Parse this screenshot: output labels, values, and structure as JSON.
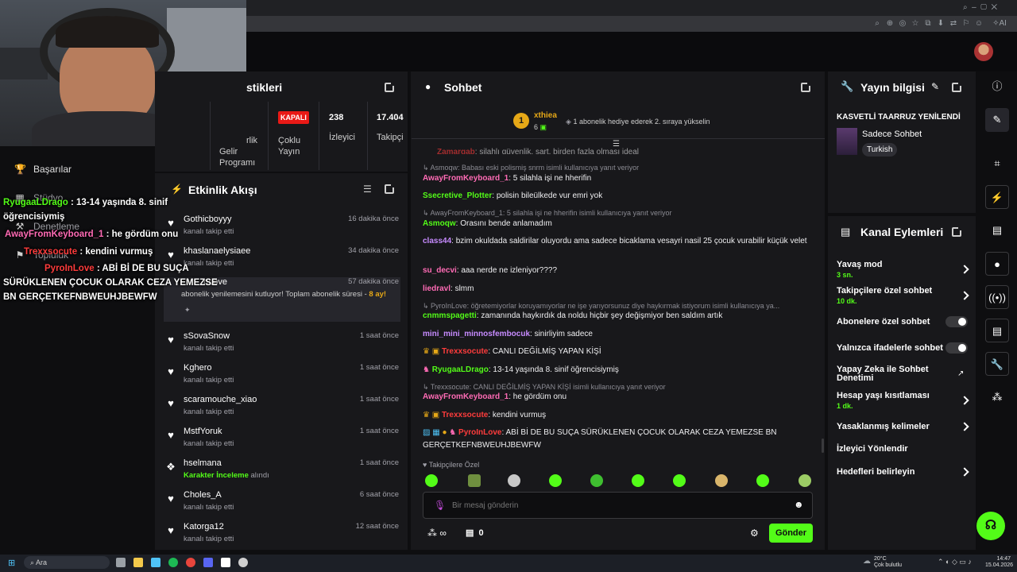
{
  "colors": {
    "accent": "#53fc18",
    "panel": "#18181b",
    "bg": "#0e0e10",
    "live_off": "#e91916",
    "sub_gold": "#e6a817"
  },
  "left_nav": {
    "items": [
      {
        "label": "Başarılar",
        "icon": "trophy-icon"
      },
      {
        "label": "Stüdyo",
        "icon": "studio-icon"
      },
      {
        "label": "Denetleme",
        "icon": "shield-icon"
      },
      {
        "label": "Topluluk",
        "icon": "community-icon"
      }
    ]
  },
  "overlay_chat": [
    {
      "user": "RyugaaLDrago",
      "text": " : 13-14 yaşında 8. sinif"
    },
    {
      "text": "öğrencisiymiş"
    },
    {
      "user": "AwayFromKeyboard_1",
      "text": " : he gördüm onu"
    },
    {
      "user": "Trexxsocute",
      "text": " : kendini vurmuş"
    },
    {
      "user": "PyroInLove",
      "text": " : ABİ Bİ DE BU SUÇA"
    },
    {
      "text": "SÜRÜKLENEN ÇOCUK OLARAK CEZA YEMEZSE"
    },
    {
      "text": "BN GERÇETKEFNBWEUHJBEWFW"
    }
  ],
  "stats_panel": {
    "title": "stikleri",
    "cols": [
      {
        "label1": "rlik",
        "label2": "Gelir Programı"
      },
      {
        "badge": "KAPALI",
        "label": "Çoklu Yayın"
      },
      {
        "value": "238",
        "label": "İzleyici"
      },
      {
        "value": "17.404",
        "label": "Takipçi"
      }
    ]
  },
  "activity": {
    "title": "Etkinlik Akışı",
    "rows": [
      {
        "user": "Gothicboyyy",
        "desc": "kanalı takip etti",
        "time": "16 dakika önce",
        "icon": "heart-icon"
      },
      {
        "user": "khaslanaelysiaee",
        "desc": "kanalı takip etti",
        "time": "34 dakika önce",
        "icon": "heart-icon"
      },
      {
        "user": "nLove",
        "desc": "abonelik yenilemesini kutluyor! Toplam abonelik süresi - ",
        "months": "8 ay!",
        "time": "57 dakika önce",
        "icon": "subscription-icon"
      },
      {
        "user": "sSovaSnow",
        "desc": "kanalı takip etti",
        "time": "1 saat önce",
        "icon": "heart-icon"
      },
      {
        "user": "Kghero",
        "desc": "kanalı takip etti",
        "time": "1 saat önce",
        "icon": "heart-icon"
      },
      {
        "user": "scaramouche_xiao",
        "desc": "kanalı takip etti",
        "time": "1 saat önce",
        "icon": "heart-icon"
      },
      {
        "user": "MstfYoruk",
        "desc": "kanalı takip etti",
        "time": "1 saat önce",
        "icon": "heart-icon"
      },
      {
        "user": "hselmana",
        "desc_link": "Karakter İnceleme",
        "desc": " alındı",
        "time": "1 saat önce",
        "icon": "reward-icon"
      },
      {
        "user": "Choles_A",
        "desc": "kanalı takip etti",
        "time": "6 saat önce",
        "icon": "heart-icon"
      },
      {
        "user": "Katorga12",
        "desc": "kanalı takip etti",
        "time": "12 saat önce",
        "icon": "heart-icon"
      }
    ]
  },
  "chat": {
    "title": "Sohbet",
    "pinned": {
      "rank": "1",
      "user": "xthiea",
      "count": "6",
      "text": "1 abonelik hediye ederek 2. sıraya yükselin"
    },
    "messages": [
      {
        "type": "cut",
        "user": "Zamargab",
        "text": ": silahlı güvenlik. şart. birden fazla olması ideal"
      },
      {
        "type": "reply",
        "text": "Asmoqw: Babası eski polismiş snrm isimli kullanıcıya yanıt veriyor"
      },
      {
        "user": "AwayFromKeyboard_1",
        "color": "#ff6bb5",
        "text": ": 5 silahla işi ne hherifin"
      },
      {
        "user": "Ssecretive_Plotter",
        "color": "#53fc18",
        "text": ": polisin bileülkede vur emri yok"
      },
      {
        "type": "reply",
        "text": "AwayFromKeyboard_1: 5 silahla işi ne hherifin isimli kullanıcıya yanıt veriyor"
      },
      {
        "user": "Asmoqw",
        "color": "#53fc18",
        "text": ": Orasını bende anlamadım"
      },
      {
        "user": "class44",
        "color": "#c78bff",
        "text": ": bzim okuldada saldirilar oluyordu ama sadece bicaklama vesayri nasil 25 çocuk vurabilir küçük velet"
      },
      {
        "user": "su_decvi",
        "color": "#ff6bb5",
        "text": ": aaa nerde ne izleniyor????"
      },
      {
        "user": "liedravl",
        "color": "#ff6bb5",
        "text": ": slmm"
      },
      {
        "type": "reply",
        "text": "PyroInLove: öğretemiyorlar koruyamıyorlar ne işe yarıyorsunuz diye haykırmak istiyorum isimli kullanıcıya ya..."
      },
      {
        "user": "cnmmspagetti",
        "color": "#53fc18",
        "text": ": zamanında haykırdık da noldu hiçbir şey değişmiyor ben saldım artık"
      },
      {
        "user": "mini_mini_minnosfembocuk",
        "color": "#c78bff",
        "text": ": sinirliyim sadece"
      },
      {
        "user": "Trexxsocute",
        "color": "#ff3c3c",
        "text": ": CANLI DEĞİLMİŞ YAPAN KİŞİ"
      },
      {
        "user": "RyugaaLDrago",
        "color": "#53fc18",
        "text": ": 13-14 yaşında 8. sinif öğrencisiymiş"
      },
      {
        "type": "reply",
        "text": "Trexxsocute: CANLI DEĞİLMİŞ YAPAN KİŞİ isimli kullanıcıya yanıt veriyor"
      },
      {
        "user": "AwayFromKeyboard_1",
        "color": "#ff6bb5",
        "text": ": he gördüm onu"
      },
      {
        "user": "Trexxsocute",
        "color": "#ff3c3c",
        "text": ": kendini vurmuş"
      },
      {
        "user": "PyroInLove",
        "color": "#ff3c3c",
        "text": ": ABİ Bİ DE BU SUÇA SÜRÜKLENEN ÇOCUK OLARAK CEZA YEMEZSE BN GERÇETKEFNBWEUHJBEWFW"
      }
    ],
    "followers_only": "Takipçilere Özel",
    "input_placeholder": "Bir mesaj gönderin",
    "points_value": "∞",
    "store_value": "0",
    "send_label": "Gönder"
  },
  "stream_info": {
    "title": "Yayın bilgisi",
    "stream_title": "KASVETLİ TAARRUZ YENİLENDİ",
    "category": "Sadece Sohbet",
    "tag": "Turkish"
  },
  "channel_actions": {
    "title": "Kanal Eylemleri",
    "items": [
      {
        "label": "Yavaş mod",
        "sub": "3 sn.",
        "control": "chevron"
      },
      {
        "label": "Takipçilere özel sohbet",
        "sub": "10 dk.",
        "control": "chevron"
      },
      {
        "label": "Abonelere özel sohbet",
        "control": "toggle"
      },
      {
        "label": "Yalnızca ifadelerle sohbet",
        "control": "toggle"
      },
      {
        "label": "Yapay Zeka ile Sohbet Denetimi",
        "control": "external"
      },
      {
        "label": "Hesap yaşı kısıtlaması",
        "sub": "1 dk.",
        "control": "chevron"
      },
      {
        "label": "Yasaklanmış kelimeler",
        "control": "chevron"
      },
      {
        "label": "İzleyici Yönlendir",
        "control": "none"
      },
      {
        "label": "Hedefleri belirleyin",
        "control": "chevron"
      }
    ]
  },
  "taskbar": {
    "search": "Ara",
    "weather_temp": "20°C",
    "weather_desc": "Çok bulutlu",
    "time": "14:47",
    "date": "15.04.2026"
  }
}
